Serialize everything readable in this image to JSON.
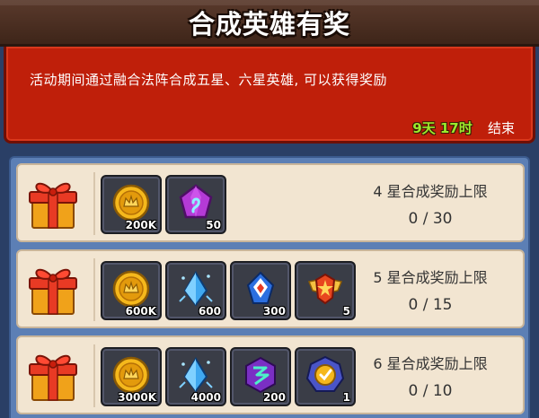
{
  "header": {
    "title": "合成英雄有奖"
  },
  "info": {
    "description": "活动期间通过融合法阵合成五星、六星英雄, 可以获得奖励",
    "time_left": "9天 17时",
    "end_label": "结束"
  },
  "rewards": [
    {
      "label": "4 星合成奖励上限",
      "progress": "0 / 30",
      "items": [
        {
          "icon": "gold-coin-icon",
          "qty": "200K"
        },
        {
          "icon": "purple-gem-icon",
          "qty": "50"
        }
      ]
    },
    {
      "label": "5 星合成奖励上限",
      "progress": "0 / 15",
      "items": [
        {
          "icon": "gold-coin-icon",
          "qty": "600K"
        },
        {
          "icon": "blue-crystal-icon",
          "qty": "600"
        },
        {
          "icon": "blue-spirit-icon",
          "qty": "300"
        },
        {
          "icon": "winged-badge-icon",
          "qty": "5"
        }
      ]
    },
    {
      "label": "6 星合成奖励上限",
      "progress": "0 / 10",
      "items": [
        {
          "icon": "gold-coin-icon",
          "qty": "3000K"
        },
        {
          "icon": "blue-crystal-icon",
          "qty": "4000"
        },
        {
          "icon": "purple-rune-icon",
          "qty": "200"
        },
        {
          "icon": "medal-icon",
          "qty": "1"
        }
      ]
    }
  ],
  "colors": {
    "accent_red": "#bf1f0a",
    "timer_green": "#9bea2c",
    "list_blue": "#5c7fb5",
    "row_cream": "#f2e5d1"
  }
}
